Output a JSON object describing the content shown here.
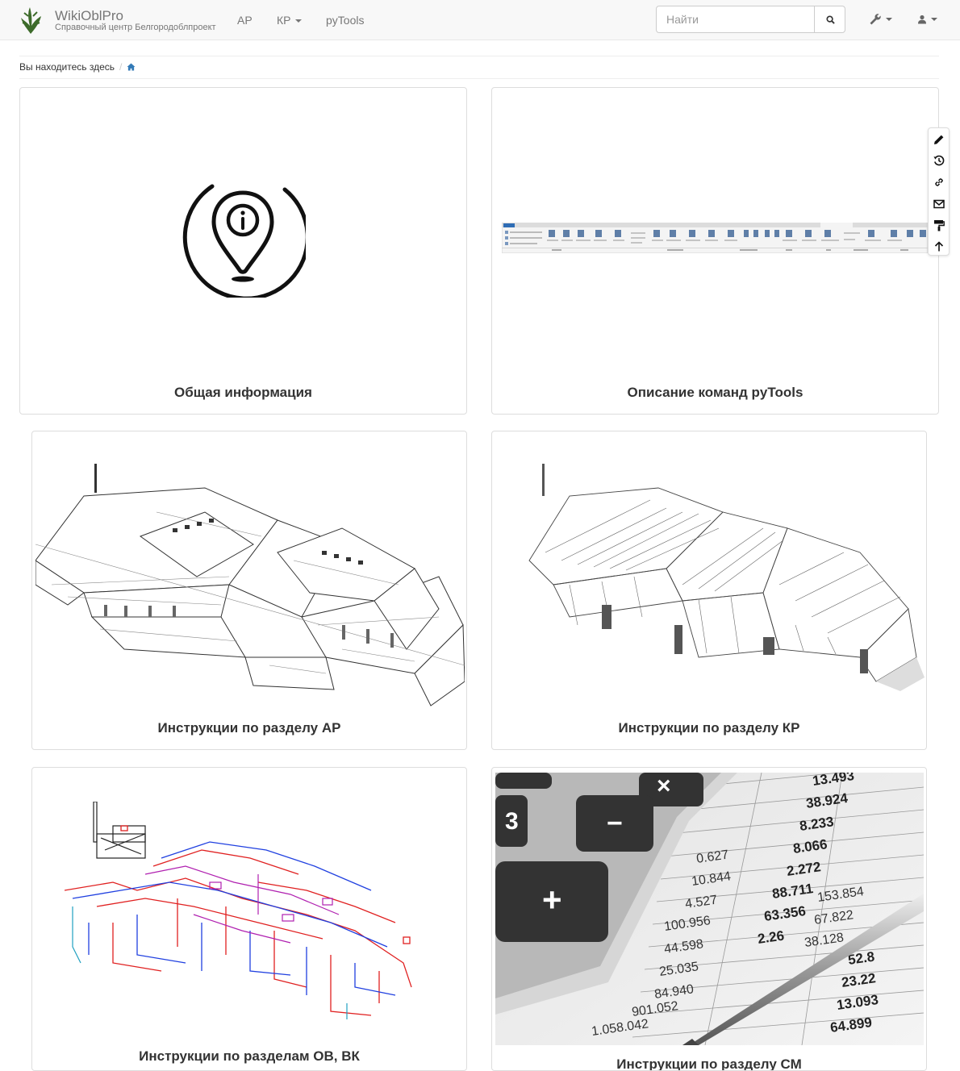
{
  "navbar": {
    "brand_title": "WikiOblPro",
    "brand_subtitle": "Справочный центр Белгородоблпроект",
    "menu": [
      {
        "label": "АР"
      },
      {
        "label": "КР"
      },
      {
        "label": "pyTools"
      }
    ],
    "search_placeholder": "Найти",
    "tools_icon": "wrench-icon",
    "user_icon": "user-icon"
  },
  "breadcrumb": {
    "prefix": "Вы находитесь здесь",
    "separator": "/",
    "home_icon": "home-icon"
  },
  "cards": [
    {
      "title": "Общая информация",
      "image": "info-pin-icon"
    },
    {
      "title": "Описание команд pyTools",
      "image": "revit-ribbon-screenshot"
    },
    {
      "title": "Инструкции по разделу АР",
      "image": "architecture-3d-model"
    },
    {
      "title": "Инструкции по разделу КР",
      "image": "structure-3d-model"
    },
    {
      "title": "Инструкции по разделам ОВ, ВК",
      "image": "mep-pipes-3d-model"
    },
    {
      "title": "Инструкции по разделу СМ",
      "image": "calculator-spreadsheet-photo"
    }
  ],
  "side_toolbar": [
    "edit-icon",
    "history-icon",
    "link-icon",
    "mail-icon",
    "paint-roller-icon",
    "arrow-up-icon"
  ],
  "colors": {
    "link": "#337ab7",
    "navbar_bg": "#f8f8f8",
    "logo_green": "#3d6b2a"
  }
}
